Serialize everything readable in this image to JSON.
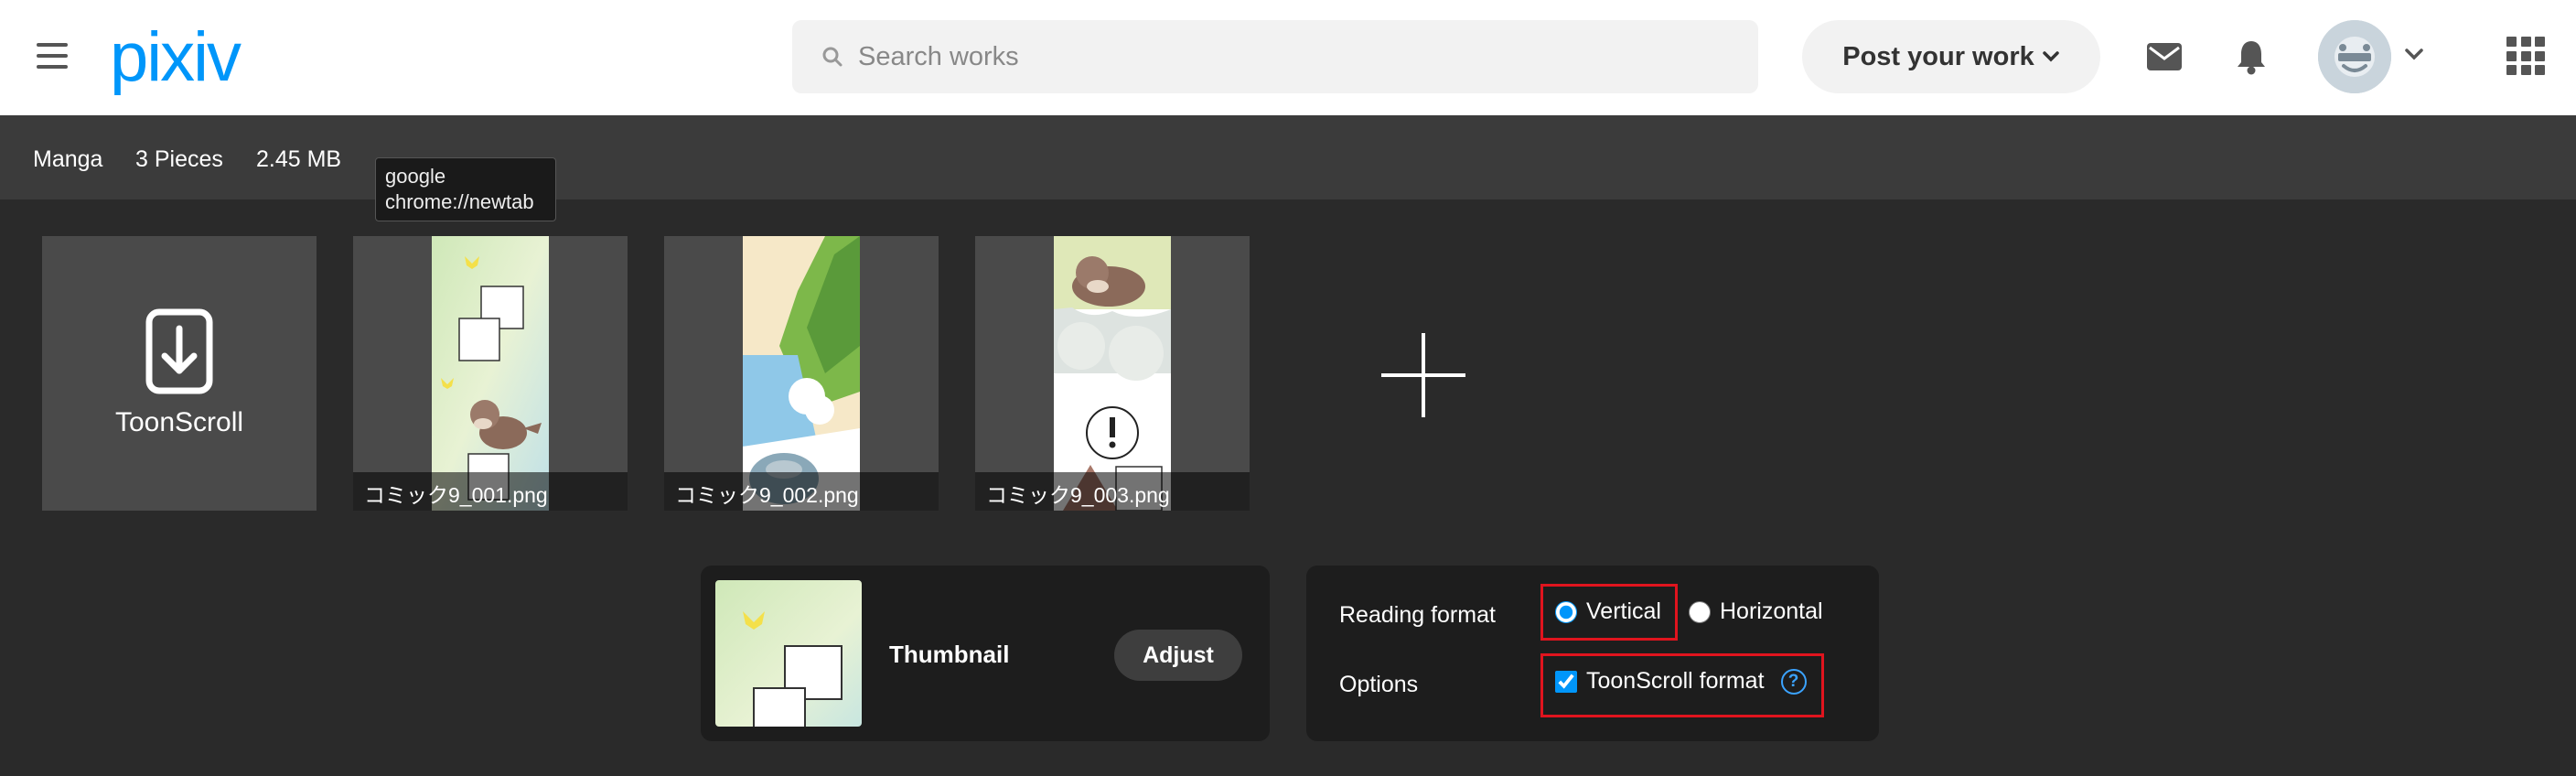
{
  "header": {
    "logo": "pixiv",
    "search_placeholder": "Search works",
    "post_button": "Post your work",
    "avatar_text": "image"
  },
  "info": {
    "type": "Manga",
    "pieces": "3 Pieces",
    "size": "2.45 MB"
  },
  "tooltip": {
    "line1": "google",
    "line2": "chrome://newtab"
  },
  "tiles": {
    "toonscroll_label": "ToonScroll",
    "files": [
      "コミック9_001.png",
      "コミック9_002.png",
      "コミック9_003.png"
    ]
  },
  "thumbnail": {
    "title": "Thumbnail",
    "adjust_button": "Adjust"
  },
  "format": {
    "reading_label": "Reading format",
    "vertical": "Vertical",
    "horizontal": "Horizontal",
    "options_label": "Options",
    "toonscroll_option": "ToonScroll format",
    "help": "?"
  },
  "colors": {
    "brand": "#0096fa",
    "highlight_border": "#e0141e"
  }
}
